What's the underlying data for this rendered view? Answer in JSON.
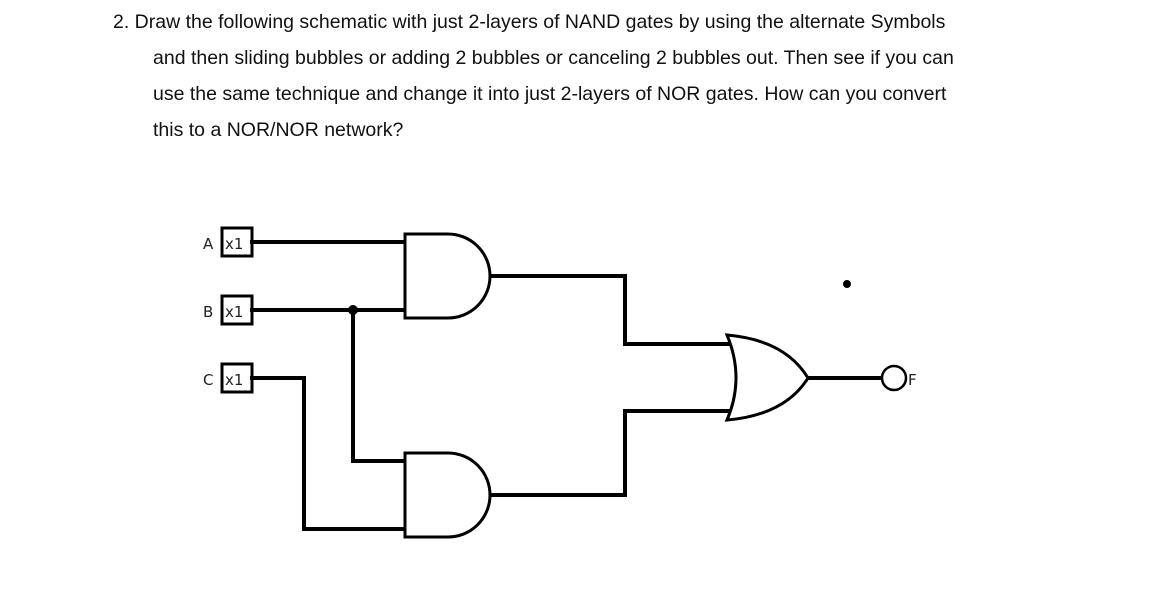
{
  "question": {
    "number": "2.",
    "lines": [
      "2. Draw the following schematic with just 2-layers of NAND gates by using the alternate Symbols",
      "and then sliding bubbles or adding 2 bubbles or canceling 2 bubbles out.  Then see if you can",
      "use the same technique and change it into just 2-layers of NOR gates.  How can you convert",
      "this to a NOR/NOR network?"
    ]
  },
  "schematic": {
    "inputs": [
      {
        "name": "A",
        "box_label": "x1"
      },
      {
        "name": "B",
        "box_label": "x1"
      },
      {
        "name": "C",
        "box_label": "x1"
      }
    ],
    "gates": [
      {
        "id": "and1",
        "type": "AND",
        "inputs": [
          "A",
          "B"
        ]
      },
      {
        "id": "and2",
        "type": "AND",
        "inputs": [
          "B",
          "C"
        ]
      },
      {
        "id": "or1",
        "type": "OR",
        "inputs": [
          "and1",
          "and2"
        ]
      }
    ],
    "output": {
      "name": "F"
    }
  }
}
